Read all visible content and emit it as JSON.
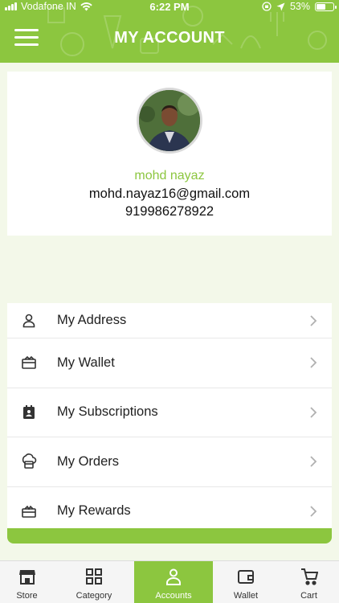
{
  "status_bar": {
    "carrier": "Vodafone IN",
    "time": "6:22 PM",
    "battery": "53%",
    "battery_level": 0.53
  },
  "header": {
    "title": "MY ACCOUNT",
    "accent_color": "#8cc63f"
  },
  "profile": {
    "name": "mohd nayaz",
    "email": "mohd.nayaz16@gmail.com",
    "phone": "919986278922"
  },
  "menu": [
    {
      "label": "My Address",
      "icon": "person-icon"
    },
    {
      "label": "My Wallet",
      "icon": "wallet-icon"
    },
    {
      "label": "My Subscriptions",
      "icon": "subscription-calendar-icon"
    },
    {
      "label": "My Orders",
      "icon": "orders-icon"
    },
    {
      "label": "My Rewards",
      "icon": "rewards-icon"
    }
  ],
  "tabs": [
    {
      "label": "Store",
      "icon": "store-icon",
      "active": false
    },
    {
      "label": "Category",
      "icon": "category-grid-icon",
      "active": false
    },
    {
      "label": "Accounts",
      "icon": "person-icon",
      "active": true
    },
    {
      "label": "Wallet",
      "icon": "wallet-icon",
      "active": false
    },
    {
      "label": "Cart",
      "icon": "cart-icon",
      "active": false
    }
  ]
}
